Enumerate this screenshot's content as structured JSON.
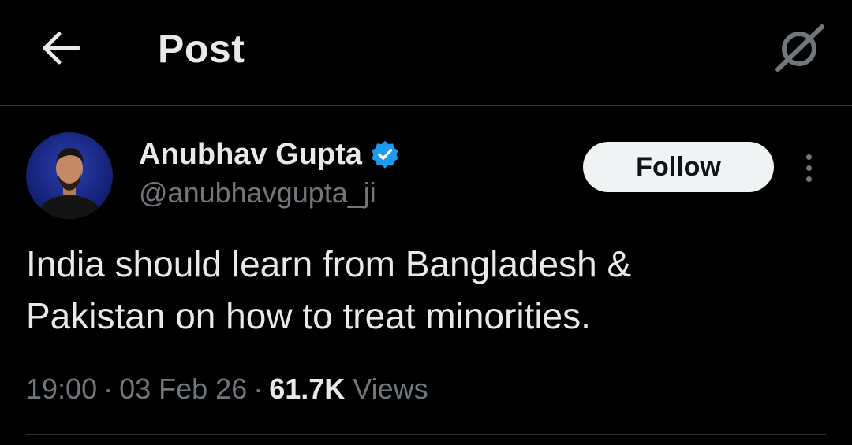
{
  "header": {
    "title": "Post",
    "back_icon": "arrow-left-icon",
    "grok_icon": "grok-icon"
  },
  "author": {
    "name": "Anubhav Gupta",
    "handle": "@anubhavgupta_ji",
    "verified": true,
    "verified_color": "#1d9bf0",
    "follow_label": "Follow"
  },
  "post": {
    "text": "India should learn from Bangladesh &\nPakistan on how to treat minorities.",
    "time": "19:00",
    "date": "03 Feb 26",
    "views_count": "61.7K",
    "views_label": "Views",
    "separator": "·"
  },
  "colors": {
    "background": "#000000",
    "primary_text": "#e7e9ea",
    "secondary_text": "#71767b",
    "button_bg": "#eff3f4",
    "divider": "#2f3336"
  }
}
